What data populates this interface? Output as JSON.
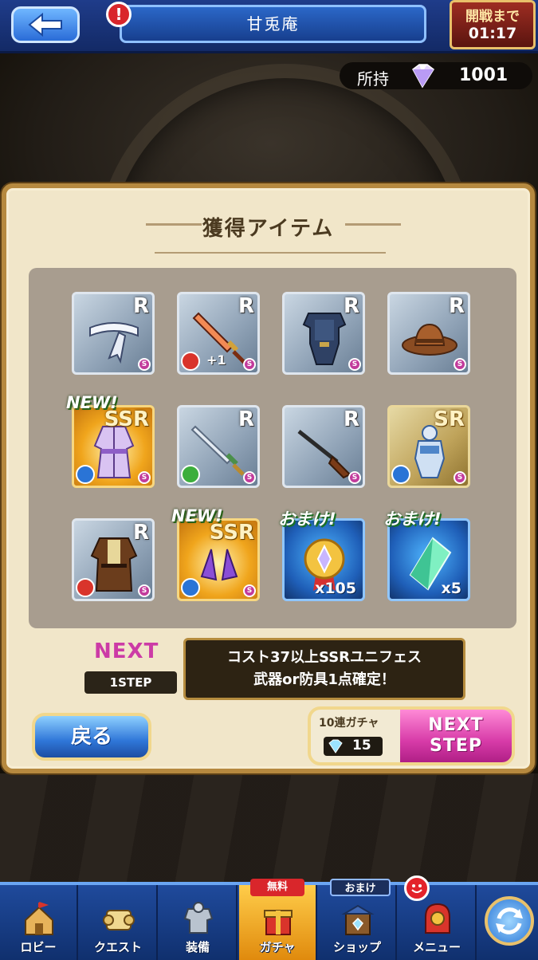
{
  "header": {
    "title": "甘兎庵",
    "timer_label": "開戦まで",
    "timer_value": "01:17",
    "alert_glyph": "!"
  },
  "balance": {
    "label": "所持",
    "value": "1001",
    "icon": "gem-icon"
  },
  "panel": {
    "title": "獲得アイテム",
    "items": [
      {
        "rank": "R",
        "art": "headband",
        "element": null
      },
      {
        "rank": "R",
        "art": "sword",
        "element": "fire",
        "plus": "+1"
      },
      {
        "rank": "R",
        "art": "armor",
        "element": null
      },
      {
        "rank": "R",
        "art": "cowboy-hat",
        "element": null
      },
      {
        "rank": "SSR",
        "art": "kimono",
        "element": "water",
        "tag": "NEW!"
      },
      {
        "rank": "R",
        "art": "dagger",
        "element": "wind"
      },
      {
        "rank": "R",
        "art": "rifle",
        "element": null
      },
      {
        "rank": "SR",
        "art": "knight-armor",
        "element": "water"
      },
      {
        "rank": "R",
        "art": "coat",
        "element": "fire"
      },
      {
        "rank": "SSR",
        "art": "crystal-horns",
        "element": "water",
        "tag": "NEW!"
      },
      {
        "rank": "",
        "art": "medal",
        "tag": "おまけ!",
        "count": "x105"
      },
      {
        "rank": "",
        "art": "green-crystal",
        "tag": "おまけ!",
        "count": "x5"
      }
    ],
    "next_label": "NEXT",
    "step_label": "1STEP",
    "notice_line1": "コスト37以上SSRユニフェス",
    "notice_line2": "武器or防具1点確定！",
    "back_button": "戻る",
    "gacha_label": "10連ガチャ",
    "gacha_cost": "15",
    "next_step_line1": "NEXT",
    "next_step_line2": "STEP"
  },
  "nav": {
    "items": [
      {
        "label": "ロビー",
        "icon": "lobby-icon"
      },
      {
        "label": "クエスト",
        "icon": "quest-icon"
      },
      {
        "label": "装備",
        "icon": "equipment-icon"
      },
      {
        "label": "ガチャ",
        "icon": "gacha-icon",
        "tag": "無料"
      },
      {
        "label": "ショップ",
        "icon": "shop-icon",
        "tag": "おまけ"
      },
      {
        "label": "メニュー",
        "icon": "menu-icon"
      }
    ],
    "refresh_icon": "refresh-icon"
  },
  "colors": {
    "accent_blue": "#1f4a9c",
    "panel_bg": "#f1e6c9",
    "next_pink": "#d73ba8",
    "gacha_active": "#ffcd4a"
  }
}
